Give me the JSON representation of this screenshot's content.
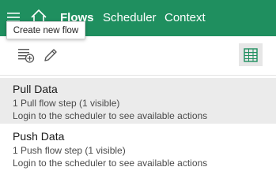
{
  "nav": {
    "menu_icon": "hamburger-menu-icon",
    "home_icon": "home-icon",
    "tabs": [
      {
        "label": "Flows"
      },
      {
        "label": "Scheduler"
      },
      {
        "label": "Context"
      }
    ]
  },
  "tooltip": {
    "text": "Create new flow"
  },
  "toolbar": {
    "new_flow_icon": "add-flow-icon",
    "edit_icon": "pencil-icon",
    "grid_icon": "table-view-icon"
  },
  "flows": [
    {
      "name": "Pull Data",
      "steps": "1 Pull flow step (1 visible)",
      "login": "Login to the scheduler to see available actions"
    },
    {
      "name": "Push Data",
      "steps": "1 Push flow step (1 visible)",
      "login": "Login to the scheduler to see available actions"
    }
  ],
  "colors": {
    "accent": "#1f8f5f",
    "selected_row": "#ebebeb"
  }
}
